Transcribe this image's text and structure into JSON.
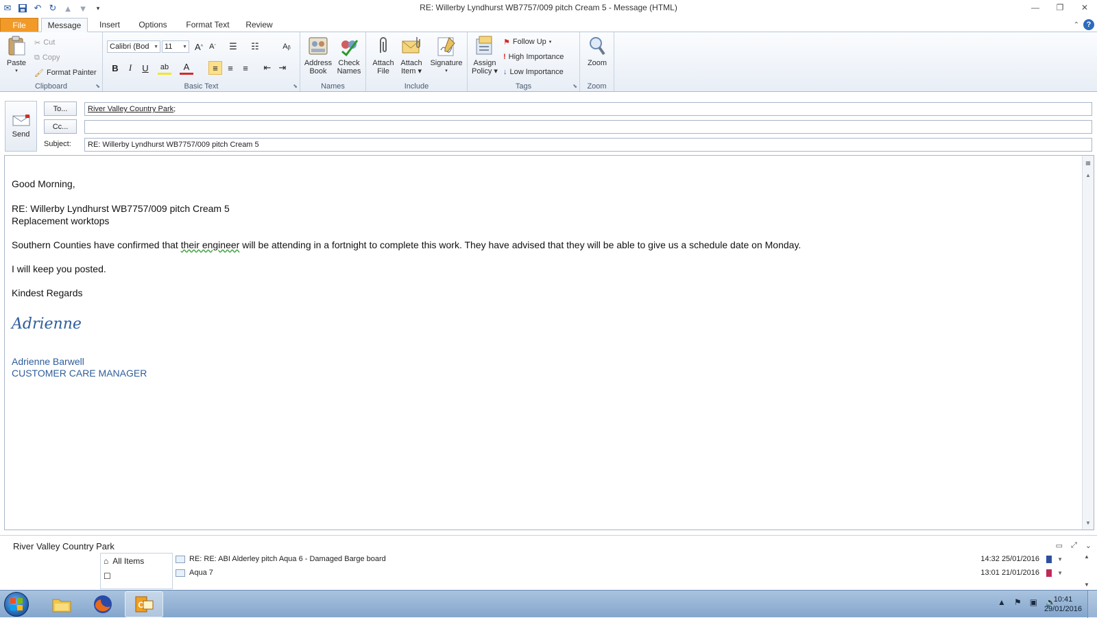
{
  "window": {
    "title": "RE: Willerby Lyndhurst WB7757/009 pitch Cream 5  -  Message (HTML)"
  },
  "tabs": [
    "File",
    "Message",
    "Insert",
    "Options",
    "Format Text",
    "Review"
  ],
  "ribbon": {
    "clipboard": {
      "paste": "Paste",
      "cut": "Cut",
      "copy": "Copy",
      "format_painter": "Format Painter",
      "label": "Clipboard"
    },
    "basic_text": {
      "font": "Calibri (Bod",
      "size": "11",
      "label": "Basic Text"
    },
    "names": {
      "address_book_1": "Address",
      "address_book_2": "Book",
      "check_names_1": "Check",
      "check_names_2": "Names",
      "label": "Names"
    },
    "include": {
      "attach_file_1": "Attach",
      "attach_file_2": "File",
      "attach_item_1": "Attach",
      "attach_item_2": "Item",
      "signature": "Signature",
      "label": "Include"
    },
    "tags": {
      "assign_policy_1": "Assign",
      "assign_policy_2": "Policy",
      "follow_up": "Follow Up",
      "high_importance": "High Importance",
      "low_importance": "Low Importance",
      "label": "Tags"
    },
    "zoom": {
      "zoom": "Zoom",
      "label": "Zoom"
    }
  },
  "compose": {
    "send": "Send",
    "to_button": "To...",
    "cc_button": "Cc...",
    "subject_label": "Subject:",
    "to_value": "River Valley Country Park",
    "to_sep": ";",
    "cc_value": "",
    "subject_value": "RE: Willerby Lyndhurst WB7757/009 pitch Cream 5"
  },
  "body": {
    "greeting": "Good Morning,",
    "ref_line": "RE: Willerby Lyndhurst WB7757/009 pitch Cream 5",
    "ref_line2": "Replacement worktops",
    "para1_a": "Southern Counties have confirmed that ",
    "para1_squig": "their  engineer",
    "para1_b": " will be attending in a fortnight to complete this work.  They have advised that they will be able to give us a schedule date on Monday.",
    "para2": "I will keep you posted.",
    "closing": "Kindest Regards",
    "signature_script": "Adrienne",
    "sig_name": "Adrienne Barwell",
    "sig_title": "CUSTOMER CARE MANAGER"
  },
  "people_pane": {
    "contact": "River Valley Country Park",
    "filter_all": "All Items",
    "items": [
      {
        "subject": "RE: RE: ABI Alderley pitch Aqua 6 - Damaged Barge board",
        "date": "14:32  25/01/2016"
      },
      {
        "subject": "Aqua 7",
        "date": "13:01  21/01/2016"
      }
    ]
  },
  "taskbar": {
    "time": "10:41",
    "date": "29/01/2016"
  },
  "colors": {
    "file_tab": "#f19a28",
    "signature_blue": "#2e5d9c",
    "taskbar": "#a9c3df"
  }
}
